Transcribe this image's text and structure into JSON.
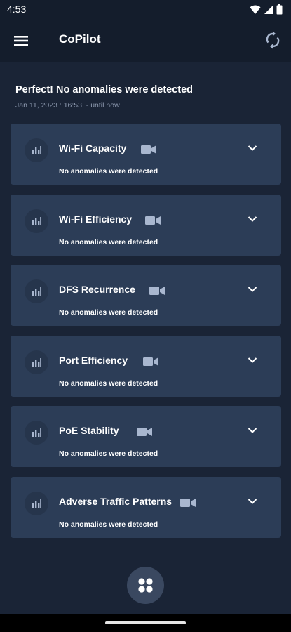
{
  "status_bar": {
    "time": "4:53"
  },
  "app_bar": {
    "title": "CoPilot"
  },
  "summary": {
    "title": "Perfect! No anomalies were detected",
    "time_range": "Jan 11, 2023 : 16:53: - until now"
  },
  "cards": [
    {
      "title": "Wi-Fi Capacity",
      "status": "No anomalies were detected"
    },
    {
      "title": "Wi-Fi Efficiency",
      "status": "No anomalies were detected"
    },
    {
      "title": "DFS Recurrence",
      "status": "No anomalies were detected"
    },
    {
      "title": "Port Efficiency",
      "status": "No anomalies were detected"
    },
    {
      "title": "PoE Stability",
      "status": "No anomalies were detected"
    },
    {
      "title": "Adverse Traffic Patterns",
      "status": "No anomalies were detected"
    }
  ],
  "icons": {
    "menu": "hamburger-menu-icon",
    "refresh": "refresh-icon",
    "card_badge": "bar-chart-icon",
    "card_video": "video-camera-icon",
    "card_expand": "chevron-down-icon",
    "fab": "grid-icon"
  },
  "colors": {
    "background": "#1a2436",
    "app_bar": "#141d2c",
    "card": "#2c3d57",
    "accent_icon": "#a9b7cf",
    "fab": "#3a4860"
  }
}
